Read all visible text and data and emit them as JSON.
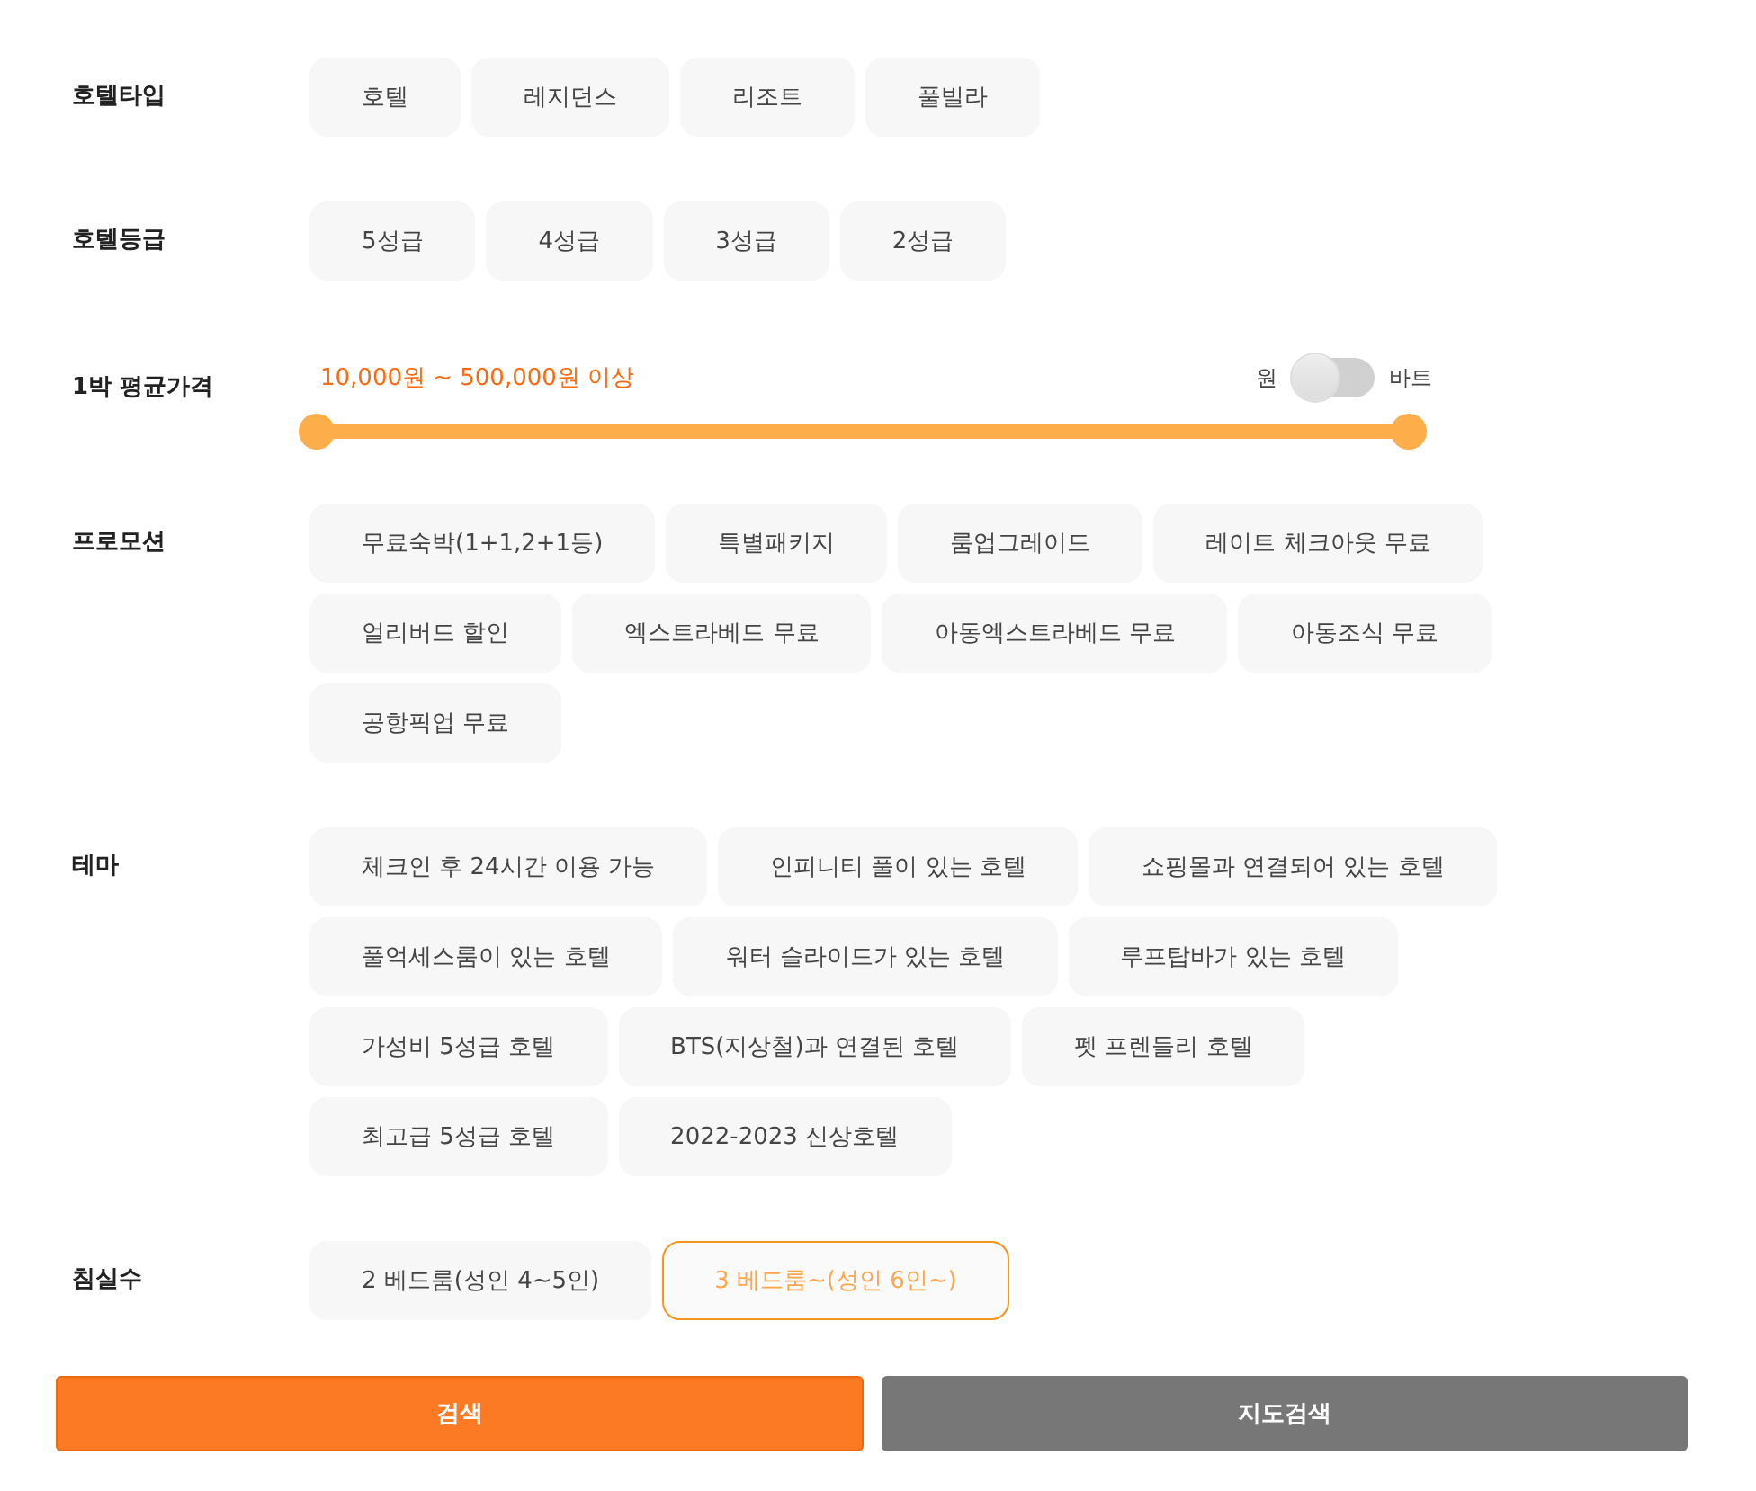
{
  "filters": [
    {
      "kind": "chips",
      "label": "호텔타입",
      "options": [
        {
          "label": "호텔",
          "selected": false
        },
        {
          "label": "레지던스",
          "selected": false
        },
        {
          "label": "리조트",
          "selected": false
        },
        {
          "label": "풀빌라",
          "selected": false
        }
      ]
    },
    {
      "kind": "chips",
      "label": "호텔등급",
      "options": [
        {
          "label": "5성급",
          "selected": false
        },
        {
          "label": "4성급",
          "selected": false
        },
        {
          "label": "3성급",
          "selected": false
        },
        {
          "label": "2성급",
          "selected": false
        }
      ]
    },
    {
      "kind": "range",
      "label": "1박 평균가격",
      "reading": "10,000원 ~ 500,000원 이상",
      "level": 1,
      "currency_left": "원",
      "currency_right": "바트",
      "currency_on": false
    },
    {
      "kind": "chips",
      "label": "프로모션",
      "options": [
        {
          "label": "무료숙박(1+1,2+1등)",
          "selected": false
        },
        {
          "label": "특별패키지",
          "selected": false
        },
        {
          "label": "룸업그레이드",
          "selected": false
        },
        {
          "label": "레이트 체크아웃 무료",
          "selected": false
        },
        {
          "label": "얼리버드 할인",
          "selected": false
        },
        {
          "label": "엑스트라베드 무료",
          "selected": false
        },
        {
          "label": "아동엑스트라베드 무료",
          "selected": false
        },
        {
          "label": "아동조식 무료",
          "selected": false
        },
        {
          "label": "공항픽업 무료",
          "selected": false
        }
      ]
    },
    {
      "kind": "chips",
      "label": "테마",
      "options": [
        {
          "label": "체크인 후 24시간 이용 가능",
          "selected": false
        },
        {
          "label": "인피니티 풀이 있는 호텔",
          "selected": false
        },
        {
          "label": "쇼핑몰과 연결되어 있는 호텔",
          "selected": false
        },
        {
          "label": "풀억세스룸이 있는 호텔",
          "selected": false
        },
        {
          "label": "워터 슬라이드가 있는 호텔",
          "selected": false
        },
        {
          "label": "루프탑바가 있는 호텔",
          "selected": false
        },
        {
          "label": "가성비 5성급 호텔",
          "selected": false
        },
        {
          "label": "BTS(지상철)과 연결된 호텔",
          "selected": false
        },
        {
          "label": "펫 프렌들리 호텔",
          "selected": false
        },
        {
          "label": "최고급 5성급 호텔",
          "selected": false
        },
        {
          "label": "2022-2023 신상호텔",
          "selected": false
        }
      ]
    },
    {
      "kind": "chips",
      "label": "침실수",
      "options": [
        {
          "label": "2 베드룸(성인 4~5인)",
          "selected": false
        },
        {
          "label": "3 베드룸~(성인 6인~)",
          "selected": true
        }
      ]
    }
  ],
  "buttons": [
    {
      "label": "검색",
      "kind": "primary"
    },
    {
      "label": "지도검색",
      "kind": "secondary"
    }
  ]
}
